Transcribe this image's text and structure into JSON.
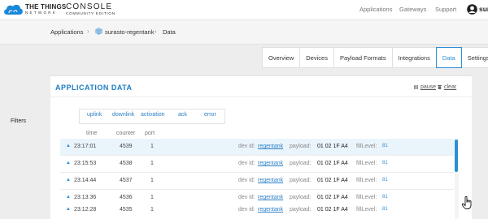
{
  "brand": {
    "org_line1": "THE THINGS",
    "org_line2": "NETWORK",
    "product": "CONSOLE",
    "edition": "COMMUNITY EDITION"
  },
  "topnav": {
    "items": [
      "Applications",
      "Gateways",
      "Support"
    ],
    "user": "sur"
  },
  "breadcrumb": {
    "items": [
      "Applications",
      "surasto-regentank",
      "Data"
    ],
    "separator": "›"
  },
  "tabs": [
    "Overview",
    "Devices",
    "Payload Formats",
    "Integrations",
    "Data",
    "Settings"
  ],
  "active_tab": "Data",
  "card": {
    "title": "APPLICATION DATA",
    "pause_label": "pause",
    "clear_label": "clear"
  },
  "filters": {
    "label": "Filters",
    "items": [
      "uplink",
      "downlink",
      "activation",
      "ack",
      "error"
    ]
  },
  "columns": {
    "time": "time",
    "counter": "counter",
    "port": "port"
  },
  "rows": [
    {
      "time": "23:17:01",
      "counter": "4539",
      "port": "1",
      "dev_id_label": "dev id:",
      "dev_id": "regentank",
      "payload_label": "payload:",
      "payload": "01 02 1F A4",
      "field_label": "fillLevel:",
      "field_value": "81"
    },
    {
      "time": "23:15:53",
      "counter": "4538",
      "port": "1",
      "dev_id_label": "dev id:",
      "dev_id": "regentank",
      "payload_label": "payload:",
      "payload": "01 02 1F A4",
      "field_label": "fillLevel:",
      "field_value": "81"
    },
    {
      "time": "23:14:44",
      "counter": "4537",
      "port": "1",
      "dev_id_label": "dev id:",
      "dev_id": "regentank",
      "payload_label": "payload:",
      "payload": "01 02 1F A4",
      "field_label": "fillLevel:",
      "field_value": "81"
    },
    {
      "time": "23:13:36",
      "counter": "4536",
      "port": "1",
      "dev_id_label": "dev id:",
      "dev_id": "regentank",
      "payload_label": "payload:",
      "payload": "01 02 1F A4",
      "field_label": "fillLevel:",
      "field_value": "81"
    },
    {
      "time": "23:12:28",
      "counter": "4535",
      "port": "1",
      "dev_id_label": "dev id:",
      "dev_id": "regentank",
      "payload_label": "payload:",
      "payload": "01 02 1F A4",
      "field_label": "fillLevel:",
      "field_value": "81"
    }
  ],
  "colors": {
    "accent": "#2b8fd6",
    "title": "#1d7ec4",
    "row_highlight": "#eaf4fb"
  }
}
